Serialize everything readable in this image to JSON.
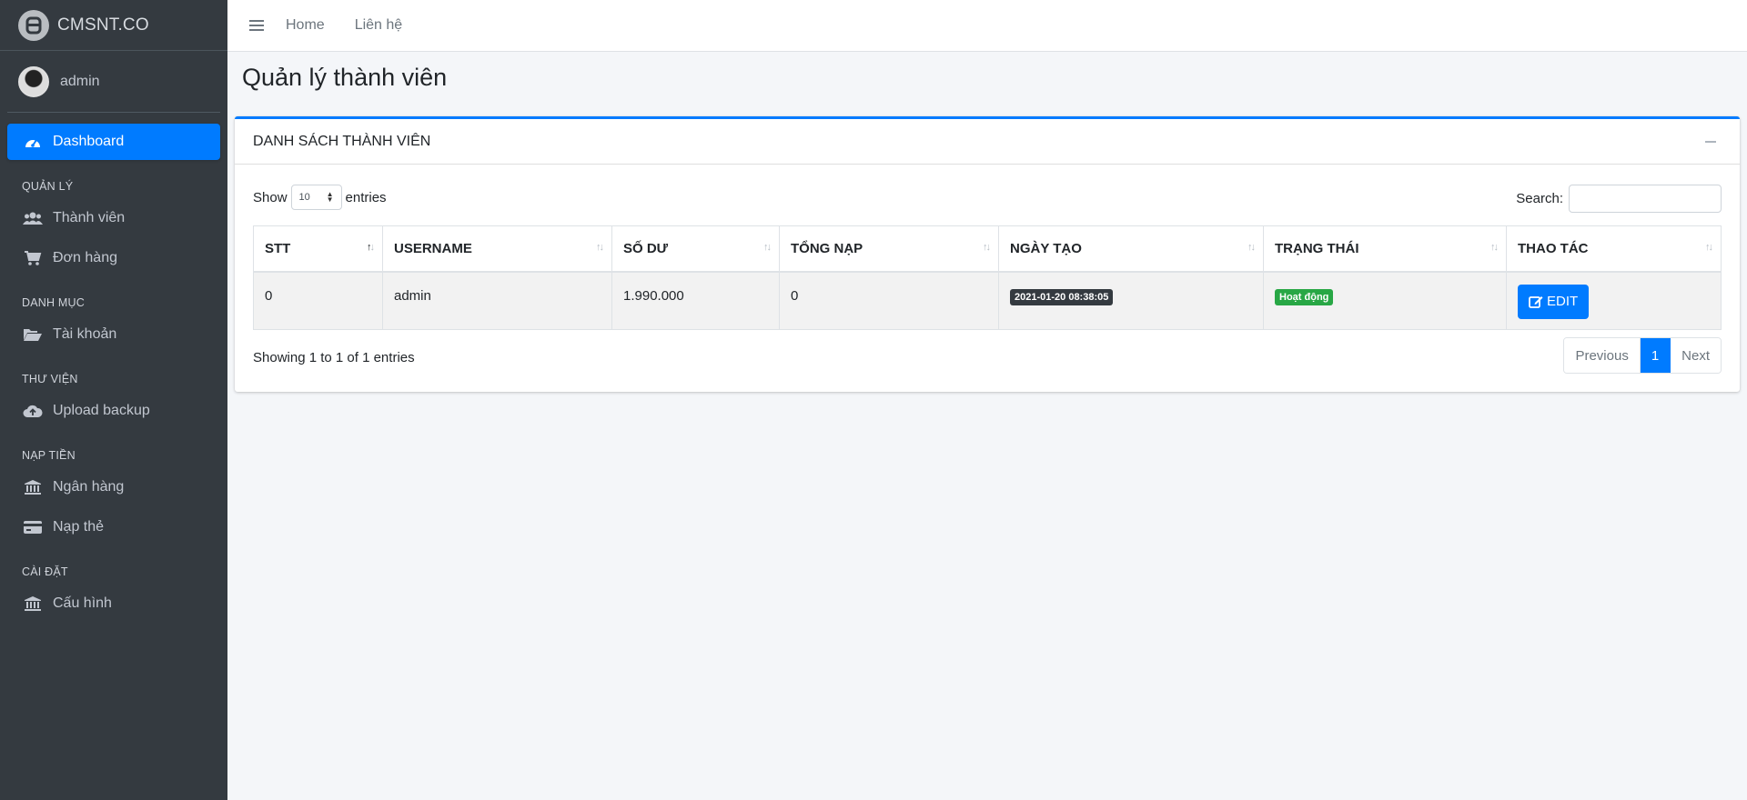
{
  "brand": {
    "name": "CMSNT.CO"
  },
  "user": {
    "name": "admin"
  },
  "sidebar": {
    "dashboard": "Dashboard",
    "sections": [
      {
        "header": "QUẢN LÝ",
        "items": [
          {
            "label": "Thành viên",
            "icon": "users-icon"
          },
          {
            "label": "Đơn hàng",
            "icon": "cart-icon"
          }
        ]
      },
      {
        "header": "DANH MỤC",
        "items": [
          {
            "label": "Tài khoản",
            "icon": "folder-open-icon"
          }
        ]
      },
      {
        "header": "THƯ VIỆN",
        "items": [
          {
            "label": "Upload backup",
            "icon": "cloud-upload-icon"
          }
        ]
      },
      {
        "header": "NẠP TIỀN",
        "items": [
          {
            "label": "Ngân hàng",
            "icon": "bank-icon"
          },
          {
            "label": "Nạp thẻ",
            "icon": "credit-card-icon"
          }
        ]
      },
      {
        "header": "CÀI ĐẶT",
        "items": [
          {
            "label": "Cấu hình",
            "icon": "bank-icon"
          }
        ]
      }
    ]
  },
  "topbar": {
    "links": [
      "Home",
      "Liên hệ"
    ]
  },
  "page": {
    "title": "Quản lý thành viên"
  },
  "card": {
    "title": "DANH SÁCH THÀNH VIÊN"
  },
  "datatable": {
    "show_label": "Show",
    "entries_label": "entries",
    "page_length": "10",
    "search_label": "Search:",
    "search_value": "",
    "columns": [
      "STT",
      "USERNAME",
      "SỐ DƯ",
      "TỔNG NẠP",
      "NGÀY TẠO",
      "TRẠNG THÁI",
      "THAO TÁC"
    ],
    "rows": [
      {
        "stt": "0",
        "username": "admin",
        "so_du": "1.990.000",
        "tong_nap": "0",
        "ngay_tao": "2021-01-20 08:38:05",
        "trang_thai": "Hoạt động",
        "action": "EDIT"
      }
    ],
    "info": "Showing 1 to 1 of 1 entries",
    "pagination": {
      "previous": "Previous",
      "current": "1",
      "next": "Next"
    }
  },
  "colors": {
    "primary": "#007bff",
    "sidebar_bg": "#343a40",
    "success": "#28a745",
    "dark": "#343a40"
  }
}
